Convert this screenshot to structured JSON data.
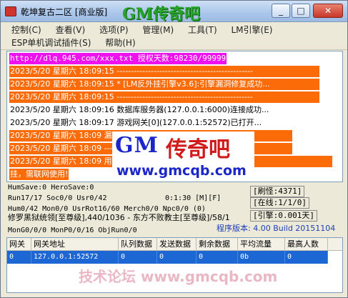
{
  "window": {
    "title": "乾坤复古二区 [商业版]",
    "brand": "GM传奇吧",
    "buttons": {
      "minimize": "_",
      "maximize": "□",
      "close": "✕"
    }
  },
  "menu": {
    "row1": [
      "控制(C)",
      "查看(V)",
      "选项(P)",
      "管理(M)",
      "工具(T)",
      "LM引擎(E)"
    ],
    "row2": [
      "ESP单机调试插件(S)",
      "帮助(H)"
    ]
  },
  "log": [
    {
      "style": "magenta",
      "text": "http://dlq.945.com/xxx.txt 授权天数:98230/99999"
    },
    {
      "style": "orange",
      "text": "2023/5/20 星期六 18:09:15 ------------------------------------------------"
    },
    {
      "style": "orange",
      "text": "2023/5/20 星期六 18:09:15 * [LM反外挂引擎v3.6]:引擎漏洞修复成功..."
    },
    {
      "style": "orange",
      "text": "2023/5/20 星期六 18:09:15 ------------------------------------------------"
    },
    {
      "style": "plain",
      "text": "2023/5/20 星期六 18:09:16 数据库服务器(127.0.0.1:6000)连接成功..."
    },
    {
      "style": "plain",
      "text": "2023/5/20 星期六 18:09:17 游戏网关[0](127.0.0.1:52572)已打开..."
    },
    {
      "style": "orange",
      "text": "2023/5/20 星期六 18:09                          漏洞修复成功..."
    },
    {
      "style": "orange",
      "text": "2023/5/20 星期六 18:09                          ---------------------"
    },
    {
      "style": "orange",
      "text": "2023/5/20 星期六 18:09                       用途、上限5人、不反"
    },
    {
      "style": "orange",
      "text": "挂，需联网使用!"
    }
  ],
  "watermark": {
    "gm": "GM",
    "cn": "传奇吧",
    "url": "www.gmcqb.com"
  },
  "stats": {
    "line1": "HumSave:0 HeroSave:0",
    "line2": "Run17/17 Soc0/0 Usr0/42",
    "time": "0:1:30 [M][F]",
    "line3": "Hum0/42 Mon0/0 UsrRot16/60 Merch0/0 Npc0/0 (0)",
    "line4": "修罗黑狱统领[至尊级],440/1036 - 东方不败教主[至尊级]/58/1",
    "line5": "MonG0/0/0 MonP0/0/16 ObjRun0/0",
    "refresh": "[刷怪:4371]",
    "online": "[在线:1/1/0]",
    "engine": "[引擎:0.001天]",
    "version": "程序版本: 4.00 Build 20151104"
  },
  "grid": {
    "columns": [
      "网关",
      "网关地址",
      "队列数据",
      "发送数据",
      "剩余数据",
      "平均流量",
      "最高人数"
    ],
    "rows": [
      [
        "0",
        "127.0.0.1:52572",
        "0",
        "0",
        "0",
        "0b",
        "0"
      ]
    ],
    "watermark": "技术论坛 www.gmcqb.com"
  }
}
